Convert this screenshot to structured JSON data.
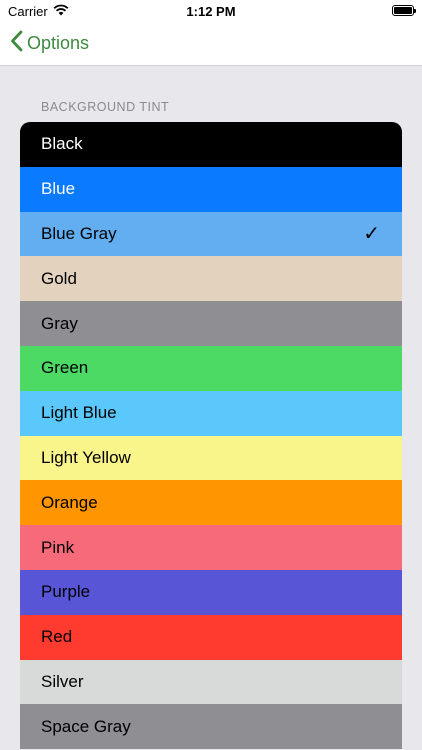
{
  "status": {
    "carrier": "Carrier",
    "time": "1:12 PM"
  },
  "nav": {
    "back_label": "Options"
  },
  "section": {
    "header": "BACKGROUND TINT"
  },
  "options": [
    {
      "label": "Black",
      "color": "#000000",
      "text_color": "#FFFFFF",
      "selected": false
    },
    {
      "label": "Blue",
      "color": "#0A7AFF",
      "text_color": "#FFFFFF",
      "selected": false
    },
    {
      "label": "Blue Gray",
      "color": "#63AEF0",
      "text_color": "#000000",
      "selected": true
    },
    {
      "label": "Gold",
      "color": "#E2D2BE",
      "text_color": "#000000",
      "selected": false
    },
    {
      "label": "Gray",
      "color": "#8E8E93",
      "text_color": "#000000",
      "selected": false
    },
    {
      "label": "Green",
      "color": "#4CD964",
      "text_color": "#000000",
      "selected": false
    },
    {
      "label": "Light Blue",
      "color": "#5AC8FA",
      "text_color": "#000000",
      "selected": false
    },
    {
      "label": "Light Yellow",
      "color": "#FAF58A",
      "text_color": "#000000",
      "selected": false
    },
    {
      "label": "Orange",
      "color": "#FF9500",
      "text_color": "#000000",
      "selected": false
    },
    {
      "label": "Pink",
      "color": "#F76A7A",
      "text_color": "#000000",
      "selected": false
    },
    {
      "label": "Purple",
      "color": "#5856D6",
      "text_color": "#000000",
      "selected": false
    },
    {
      "label": "Red",
      "color": "#FF3B30",
      "text_color": "#000000",
      "selected": false
    },
    {
      "label": "Silver",
      "color": "#D7DAD9",
      "text_color": "#000000",
      "selected": false
    },
    {
      "label": "Space Gray",
      "color": "#8E8E93",
      "text_color": "#000000",
      "selected": false
    }
  ],
  "checkmark": "✓",
  "colors": {
    "accent": "#3E8A3E",
    "background": "#E8E7EC"
  }
}
